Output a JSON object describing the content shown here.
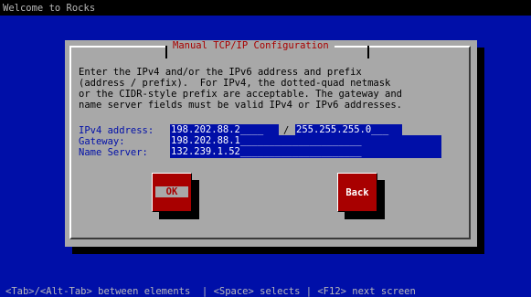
{
  "screen": {
    "title": "Welcome to Rocks",
    "help_line": "<Tab>/<Alt-Tab> between elements  | <Space> selects | <F12> next screen"
  },
  "dialog": {
    "title": "Manual TCP/IP Configuration",
    "description": "Enter the IPv4 and/or the IPv6 address and prefix\n(address / prefix).  For IPv4, the dotted-quad netmask\nor the CIDR-style prefix are acceptable. The gateway and\nname server fields must be valid IPv4 or IPv6 addresses.",
    "fields": {
      "ipv4_label": "IPv4 address:",
      "ipv4_value": "198.202.88.2____",
      "separator": "/",
      "netmask_value": "255.255.255.0___",
      "gateway_label": "Gateway:",
      "gateway_value": "198.202.88.1_____________________",
      "nameserver_label": "Name Server:",
      "nameserver_value": "132.239.1.52_____________________"
    },
    "buttons": {
      "ok_label": "OK",
      "back_label": "Back"
    }
  },
  "colors": {
    "background": "#000fa8",
    "dialog": "#a8a8a8",
    "accent": "#a80000",
    "field": "#000fa8"
  }
}
